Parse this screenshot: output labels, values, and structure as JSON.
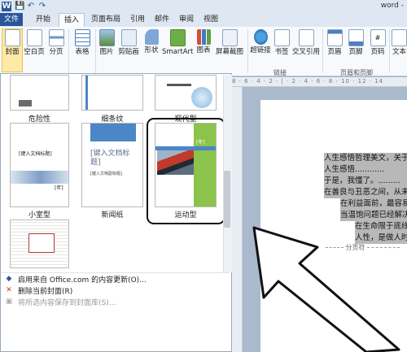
{
  "window": {
    "title": "word -"
  },
  "quick_access": [
    "W",
    "💾",
    "↶",
    "↷"
  ],
  "tabs": [
    "文件",
    "开始",
    "插入",
    "页面布局",
    "引用",
    "邮件",
    "审阅",
    "视图"
  ],
  "ribbon": {
    "buttons": [
      "封面",
      "空白页",
      "分页",
      "表格",
      "图片",
      "剪贴画",
      "形状",
      "SmartArt",
      "图表",
      "屏幕截图",
      "超链接",
      "书签",
      "交叉引用",
      "页眉",
      "页脚",
      "页码",
      "文本"
    ],
    "groups": {
      "links": "链接",
      "header_footer": "页眉和页脚"
    }
  },
  "ruler_text": "8 · 6 · 4 · 2 · | · 2 · 4 · 6 · 8 · 10 · 12 · 14",
  "gallery": {
    "items": [
      {
        "label": "危险性"
      },
      {
        "label": "细条纹"
      },
      {
        "label": "现代型"
      },
      {
        "label": "小室型",
        "title": "[键入文档标题]",
        "year": "[年]"
      },
      {
        "label": "新闻纸",
        "title": "[键入文档标题]",
        "subtitle": "[键入文档副标题]"
      },
      {
        "label": "运动型",
        "year": "[年]"
      }
    ],
    "menu": [
      "启用来自 Office.com 的内容更新(O)...",
      "删除当前封面(R)",
      "将所选内容保存到封面库(S)..."
    ]
  },
  "document": {
    "lines": [
      "人生感悟哲理美文，关于",
      "人生感悟............",
      "于是，我懂了。.........",
      "在善良与丑恶之间，从未",
      "在利益面前，最容易",
      "当温饱问题已经解决",
      "在生命限于底线",
      "人性，是做人时"
    ],
    "page_break": "分页符"
  },
  "colors": {
    "accent": "#2a5699",
    "sport_green": "#8cc34a",
    "sport_blue": "#4a86c8"
  }
}
